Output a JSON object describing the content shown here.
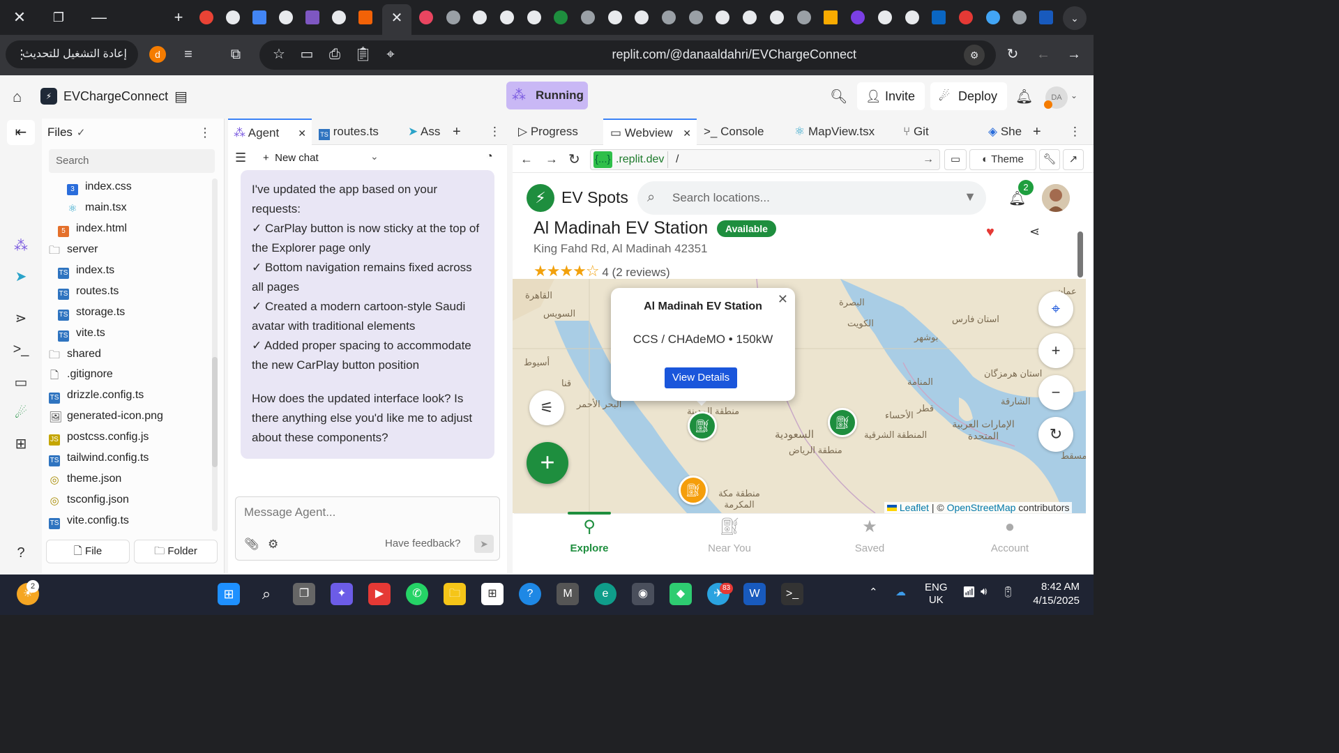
{
  "browser": {
    "reload_button_label": "إعادة التشغيل للتحديث",
    "profile_initial": "d",
    "url": "replit.com/@danaaldahri/EVChargeConnect"
  },
  "replit": {
    "project_name": "EVChargeConnect",
    "status": "Running",
    "invite_label": "Invite",
    "deploy_label": "Deploy",
    "avatar_initials": "DA"
  },
  "files_panel": {
    "title": "Files",
    "search_placeholder": "Search",
    "items": [
      {
        "name": "index.css",
        "type": "css"
      },
      {
        "name": "main.tsx",
        "type": "react"
      },
      {
        "name": "index.html",
        "type": "html"
      },
      {
        "name": "server",
        "type": "folder"
      },
      {
        "name": "index.ts",
        "type": "ts"
      },
      {
        "name": "routes.ts",
        "type": "ts"
      },
      {
        "name": "storage.ts",
        "type": "ts"
      },
      {
        "name": "vite.ts",
        "type": "ts"
      },
      {
        "name": "shared",
        "type": "folder"
      },
      {
        "name": ".gitignore",
        "type": "plain"
      },
      {
        "name": "drizzle.config.ts",
        "type": "ts"
      },
      {
        "name": "generated-icon.png",
        "type": "image"
      },
      {
        "name": "postcss.config.js",
        "type": "js"
      },
      {
        "name": "tailwind.config.ts",
        "type": "ts"
      },
      {
        "name": "theme.json",
        "type": "json"
      },
      {
        "name": "tsconfig.json",
        "type": "json"
      },
      {
        "name": "vite.config.ts",
        "type": "ts"
      }
    ],
    "new_file_label": "File",
    "new_folder_label": "Folder"
  },
  "agent_panel": {
    "tabs": [
      "Agent",
      "routes.ts",
      "Ass"
    ],
    "new_chat_label": "New chat",
    "message_paragraphs": [
      "I've updated the app based on your requests:",
      "✓ CarPlay button is now sticky at the top of the Explorer page only",
      "✓ Bottom navigation remains fixed across all pages",
      "✓ Created a modern cartoon-style Saudi avatar with traditional elements",
      "✓ Added proper spacing to accommodate the new CarPlay button position"
    ],
    "message_question": "How does the updated interface look? Is there anything else you'd like me to adjust about these components?",
    "input_placeholder": "Message Agent...",
    "feedback_label": "Have feedback?"
  },
  "webview_panel": {
    "tabs": [
      "Progress",
      "Webview",
      "Console",
      "MapView.tsx",
      "Git",
      "She"
    ],
    "url_host_badge": "{...}",
    "url_host": ".replit.dev",
    "url_path": "/",
    "theme_label": "Theme"
  },
  "ev_app": {
    "app_name": "EV Spots",
    "search_placeholder": "Search locations...",
    "notification_count": "2",
    "station": {
      "name": "Al Madinah EV Station",
      "status": "Available",
      "address": "King Fahd Rd, Al Madinah 42351",
      "rating": 4,
      "rating_text": "4 (2 reviews)"
    },
    "popup": {
      "title": "Al Madinah EV Station",
      "connectors": "CCS / CHAdeMO • 150kW",
      "button_label": "View Details"
    },
    "map_labels": [
      "القاهرة",
      "السويس",
      "أسيوط",
      "قنا",
      "البحر الأحمر",
      "البصرة",
      "الكويت",
      "استان فارس",
      "بوشهر",
      "المنامة",
      "قطر",
      "الأحساء",
      "المنطقة الشرقية",
      "الإمارات العربية المتحدة",
      "الشارقة",
      "استان هرمزگان",
      "السعودية",
      "منطقة الرياض",
      "منطقة مكة المكرمة",
      "منطقة المدينة",
      "مسقط",
      "عمان"
    ],
    "attribution": {
      "leaflet": "Leaflet",
      "separator": "| ©",
      "osm": "OpenStreetMap",
      "suffix": "contributors"
    },
    "nav": [
      {
        "label": "Explore",
        "icon": "map-pin-icon"
      },
      {
        "label": "Near You",
        "icon": "ev-station-icon"
      },
      {
        "label": "Saved",
        "icon": "star-icon"
      },
      {
        "label": "Account",
        "icon": "user-icon"
      }
    ]
  },
  "taskbar": {
    "weather_badge": "2",
    "telegram_badge": "83",
    "language": "ENG",
    "region": "UK",
    "time": "8:42 AM",
    "date": "4/15/2025"
  }
}
